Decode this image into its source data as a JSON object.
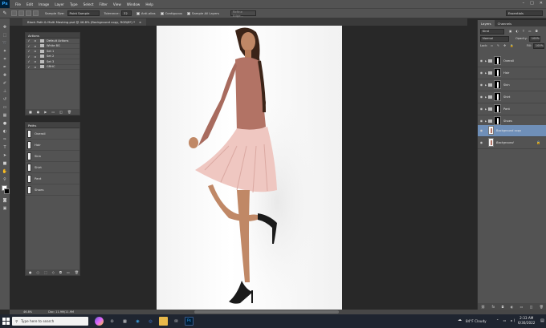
{
  "app": {
    "logo": "Ps",
    "menu": [
      "File",
      "Edit",
      "Image",
      "Layer",
      "Type",
      "Select",
      "Filter",
      "View",
      "Window",
      "Help"
    ],
    "window_buttons": [
      "–",
      "□",
      "✕"
    ]
  },
  "options": {
    "sample_size_label": "Sample Size:",
    "sample_size_value": "Point Sample",
    "tolerance_label": "Tolerance:",
    "tolerance_value": "32",
    "anti_alias": "Anti-alias",
    "contiguous": "Contiguous",
    "sample_all_layers": "Sample All Layers",
    "refine_edge": "Refine Edge...",
    "workspace": "Essentials"
  },
  "document": {
    "tab_title": "Black Path & Multi Masking.psd @ 46.8% (Background copy, RGB/8*) *",
    "tab_close": "×"
  },
  "actions_panel": {
    "title": "Actions",
    "items": [
      "Default Actions",
      "White BG",
      "Set 1",
      "Set 2",
      "Set 3",
      "GRHC"
    ]
  },
  "paths_panel": {
    "title": "Paths",
    "items": [
      "Overall",
      "Hair",
      "Skin",
      "Shirt",
      "Pant",
      "Shoes"
    ]
  },
  "layers_panel": {
    "tabs": [
      "Layers",
      "Channels"
    ],
    "kind": "Kind",
    "blend_mode": "Normal",
    "opacity_label": "Opacity:",
    "opacity_value": "100%",
    "lock_label": "Lock:",
    "fill_label": "Fill:",
    "fill_value": "100%",
    "layers": [
      {
        "name": "Overall",
        "type": "group"
      },
      {
        "name": "Hair",
        "type": "group"
      },
      {
        "name": "Skin",
        "type": "group"
      },
      {
        "name": "Shirt",
        "type": "group"
      },
      {
        "name": "Pant",
        "type": "group"
      },
      {
        "name": "Shoes",
        "type": "group"
      },
      {
        "name": "Background copy",
        "type": "pixel",
        "selected": true
      },
      {
        "name": "Background",
        "type": "pixel",
        "locked": true
      }
    ]
  },
  "status": {
    "zoom": "46.8%",
    "doc_size": "Doc: 11.9M/11.9M"
  },
  "taskbar": {
    "search_placeholder": "Type here to search",
    "weather": "84°F Cloudy",
    "time": "2:33 AM",
    "date": "6/30/2022"
  },
  "colors": {
    "ps_accent": "#31a8ff",
    "selected_layer": "#6f8fb8",
    "panel_bg": "#535353",
    "workspace_bg": "#282828"
  }
}
